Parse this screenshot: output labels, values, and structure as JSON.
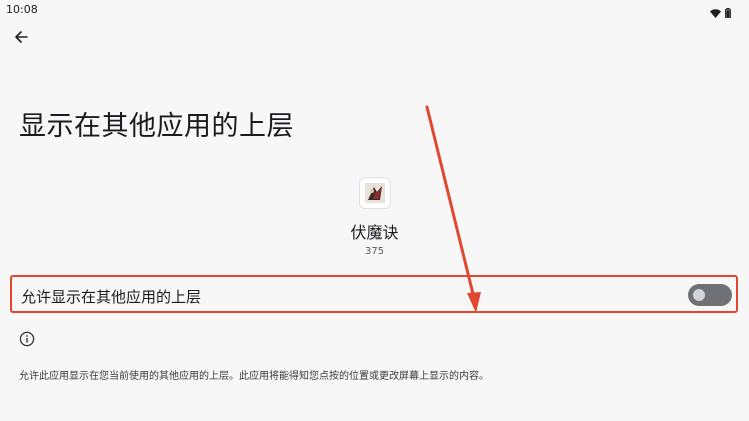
{
  "status_bar": {
    "time": "10:08",
    "icons": [
      "wifi-icon",
      "battery-icon"
    ]
  },
  "header": {
    "back_icon": "arrow-left-icon"
  },
  "page": {
    "title": "显示在其他应用的上层"
  },
  "app": {
    "name": "伏魔诀",
    "version": "375"
  },
  "toggle": {
    "label": "允许显示在其他应用的上层",
    "state": "off"
  },
  "info": {
    "icon": "info-icon",
    "description": "允许此应用显示在您当前使用的其他应用的上层。此应用将能得知您点按的位置或更改屏幕上显示的内容。"
  },
  "annotation": {
    "highlight_color": "#e0492f"
  }
}
